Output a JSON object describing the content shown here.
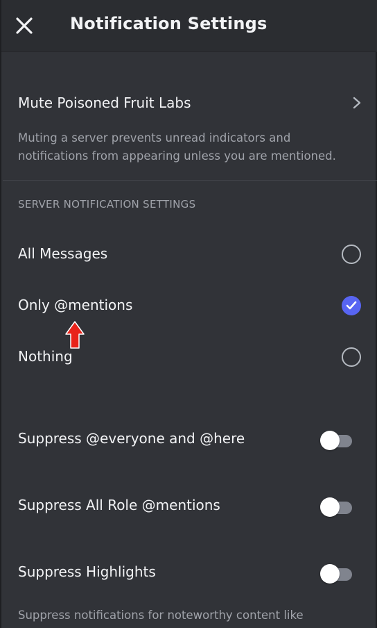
{
  "header": {
    "title": "Notification Settings",
    "close_icon": "close-icon"
  },
  "mute": {
    "label": "Mute Poisoned Fruit Labs",
    "description": "Muting a server prevents unread indicators and notifications from appearing unless you are mentioned.",
    "icon": "chevron-right-icon"
  },
  "server_notifications": {
    "section_title": "SERVER NOTIFICATION SETTINGS",
    "options": [
      {
        "label": "All Messages",
        "selected": false
      },
      {
        "label": "Only @mentions",
        "selected": true
      },
      {
        "label": "Nothing",
        "selected": false
      }
    ]
  },
  "toggles": [
    {
      "label": "Suppress @everyone and @here",
      "on": false
    },
    {
      "label": "Suppress All Role @mentions",
      "on": false
    },
    {
      "label": "Suppress Highlights",
      "on": false
    }
  ],
  "highlights_description": "Suppress notifications for noteworthy content like",
  "colors": {
    "background": "#313338",
    "header": "#2b2d31",
    "accent": "#5865f2",
    "annotation_arrow": "#e8231a",
    "muted_text": "#a0a3aa"
  }
}
